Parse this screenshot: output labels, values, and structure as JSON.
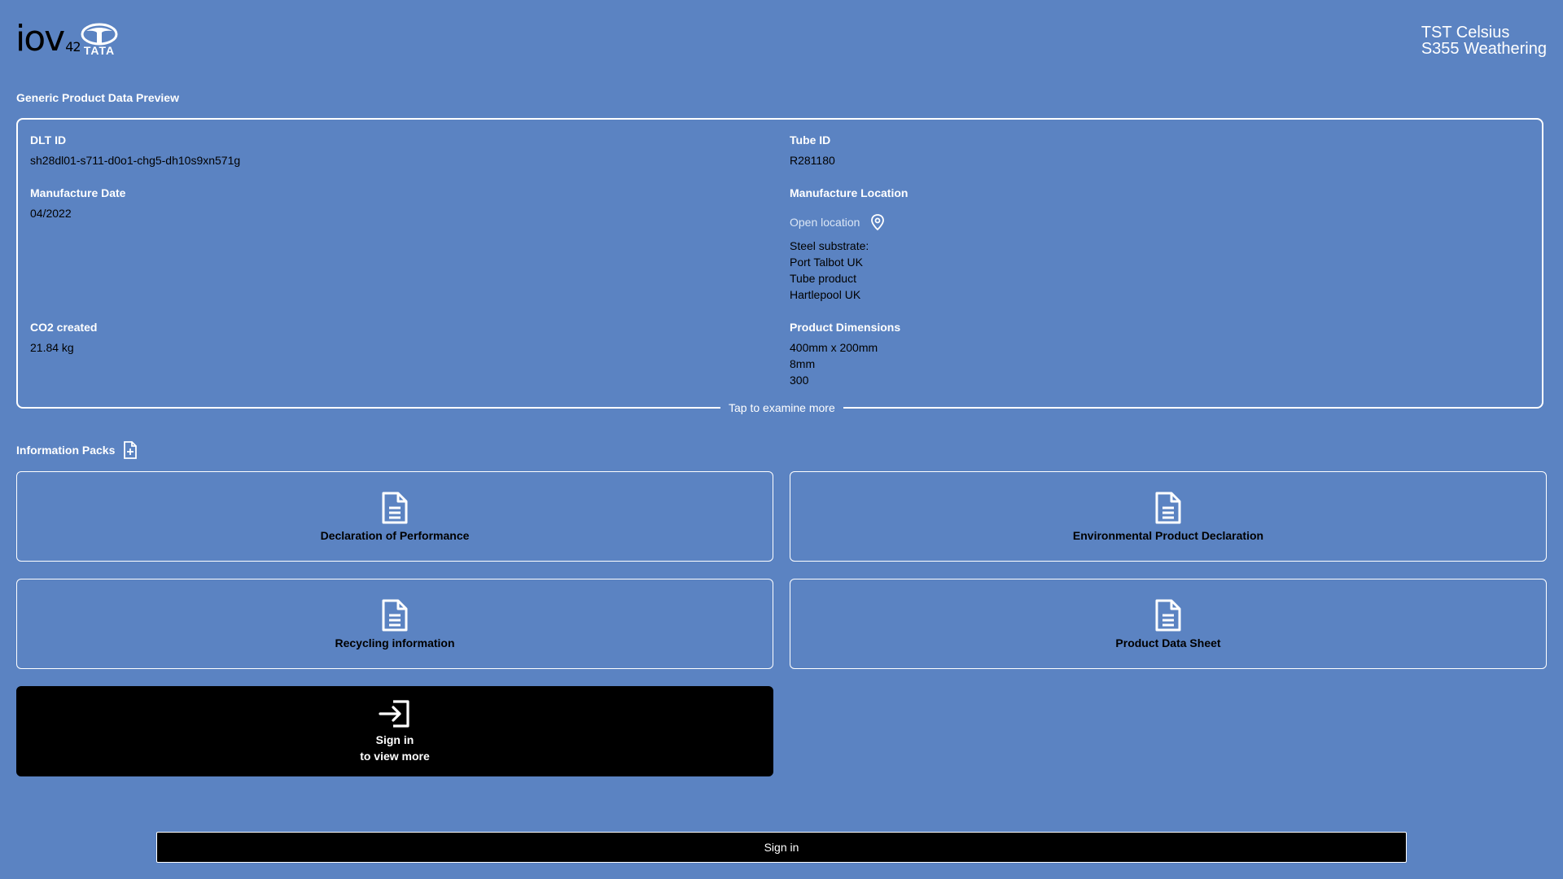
{
  "header": {
    "logo_text": "iov",
    "logo_sup": "42",
    "brand_text": "TATA",
    "product_line1": "TST Celsius",
    "product_line2": "S355 Weathering"
  },
  "preview": {
    "title": "Generic Product Data Preview",
    "dlt_id_label": "DLT ID",
    "dlt_id_value": "sh28dl01-s711-d0o1-chg5-dh10s9xn571g",
    "tube_id_label": "Tube ID",
    "tube_id_value": "R281180",
    "manufacture_date_label": "Manufacture Date",
    "manufacture_date_value": "04/2022",
    "manufacture_location_label": "Manufacture Location",
    "open_location_label": "Open location",
    "location_lines": [
      "Steel substrate:",
      "Port Talbot UK",
      "Tube product",
      "Hartlepool UK"
    ],
    "co2_label": "CO2 created",
    "co2_value": "21.84 kg",
    "dimensions_label": "Product Dimensions",
    "dimension_lines": [
      "400mm x 200mm",
      "8mm",
      "300"
    ],
    "tap_more": "Tap to examine more"
  },
  "packs": {
    "title": "Information Packs",
    "items": [
      {
        "label": "Declaration of Performance"
      },
      {
        "label": "Environmental Product Declaration"
      },
      {
        "label": "Recycling information"
      },
      {
        "label": "Product Data Sheet"
      }
    ],
    "signin_card_line1": "Sign in",
    "signin_card_line2": "to view more"
  },
  "footer": {
    "signin_button": "Sign in"
  },
  "colors": {
    "background": "#5b83c2",
    "dark": "#000000",
    "light": "#ffffff"
  }
}
